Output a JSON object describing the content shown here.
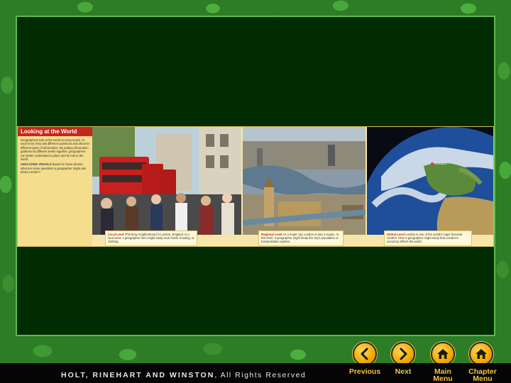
{
  "feature": {
    "title": "Looking at the World",
    "body": "Geographers look at the world at many levels. At each level, they ask different questions and discover different types of information. By putting information gathered at different levels together, geographers can better understand a place and its role in the world.",
    "question_label": "ANALYZING VISUALS",
    "question_text": "Based on these photos, what are some questions a geographer might ask about London?",
    "captions": [
      {
        "label": "Local Level",
        "text": "This busy neighborhood in London, England, is a local area. A geographer here might study local foods, housing, or clothing."
      },
      {
        "label": "Regional Level",
        "text": "As a major city, London is also a region. At this level, a geographer might study the city's population or transportation system."
      },
      {
        "label": "Global Level",
        "text": "London is one of the world's major financial centers. Here a geographer might study how London's economy affects the world."
      }
    ],
    "map_label": "London"
  },
  "nav": {
    "previous": "Previous",
    "next": "Next",
    "main_menu_line1": "Main",
    "main_menu_line2": "Menu",
    "chapter_menu_line1": "Chapter",
    "chapter_menu_line2": "Menu"
  },
  "footer": {
    "publisher": "HOLT, RINEHART AND WINSTON",
    "rights": ", All Rights Reserved"
  },
  "colors": {
    "panel": "#012b00",
    "frame_green": "#2c7d25",
    "button_gold": "#f0a800",
    "title_red": "#c8261a"
  }
}
